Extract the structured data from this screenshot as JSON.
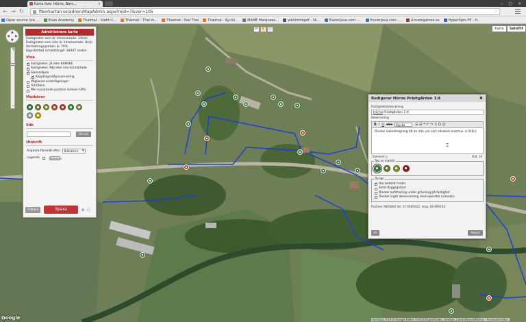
{
  "browser": {
    "tab_title": "Karta över Hörne, Bars…",
    "tab_close": "×",
    "address": "fiberkartan.se/admin/MapAdmin.aspx?mid=7&ver=105",
    "window_buttons": "– ▢ ×",
    "bookmarks": [
      {
        "label": "Open source live …",
        "color": "#3b7dd8"
      },
      {
        "label": "Khan Academy",
        "color": "#4a9e3f"
      },
      {
        "label": "Thaimat - Stekt ri…",
        "color": "#e07a1f"
      },
      {
        "label": "Thaimat - Thai m…",
        "color": "#e07a1f"
      },
      {
        "label": "Thaimat - Pad Thai",
        "color": "#e07a1f"
      },
      {
        "label": "Thaimat - Kyckli…",
        "color": "#e07a1f"
      },
      {
        "label": "MAME Marquees…",
        "color": "#777777"
      },
      {
        "label": "wkhtmltopdf - Sk…",
        "color": "#555555"
      },
      {
        "label": "EasierJava.com -…",
        "color": "#4477aa"
      },
      {
        "label": "EasierJava.com -…",
        "color": "#4477aa"
      },
      {
        "label": "Arcadegames.se",
        "color": "#aa3333"
      },
      {
        "label": "HyperSpin-FE - H…",
        "color": "#3366cc"
      }
    ]
  },
  "map": {
    "type_buttons": [
      "Karta",
      "Satellit"
    ],
    "top_icons": [
      "↶",
      "✋",
      "▭"
    ],
    "logo": "Google",
    "copyright": "Kartdata ©2013 Google Bilder ©2013 DigitalGlobe, GeoEye, Lantmäteriet/Metria – Användarvillkor",
    "pan_arrows": [
      "▲",
      "▼",
      "◀",
      "▶"
    ],
    "zoom": [
      "+",
      "−"
    ]
  },
  "admin": {
    "title": "Administrera karta",
    "stats": [
      "Fastigheter som är intresserade: 14(st)",
      "Fastigheter som inte är intresserade: 8(st)",
      "Anslutningsgraden är 79%",
      "Uppskattad schaktlängd: 34447 meter"
    ],
    "visa_header": "Visa",
    "visa_items": [
      {
        "label": "Fastigheter, JA eller KANSKE",
        "checked": true,
        "indent": false
      },
      {
        "label": "Fastigheter, NEJ eller inte kontaktade",
        "checked": true,
        "indent": false
      },
      {
        "label": "Fiberskåpen",
        "checked": true,
        "indent": false
      },
      {
        "label": "Kopplingsskåpsnumrering",
        "checked": true,
        "indent": true
      },
      {
        "label": "Vägkanal-underlägningar",
        "checked": false,
        "indent": false
      },
      {
        "label": "Områden",
        "checked": false,
        "indent": false
      },
      {
        "label": "Min nuvarande position (kräver GPS)",
        "checked": false,
        "indent": false
      }
    ],
    "markers_header": "Markörer",
    "marker_colors": [
      "#2e7d32",
      "#6d7a2a",
      "#8a8f2a",
      "#c24a1a",
      "#b23a1a",
      "#2e8a2e",
      "#8a8a2a",
      "#9aa0a6",
      "#c8a000"
    ],
    "search_header": "Sök",
    "search_button": "Sök/sök",
    "utskrift_header": "Utskrift",
    "print_label": "Anpassa föremål efter",
    "print_select": "Bildskärm",
    "legend_label": "Legende",
    "legend_toggle": "Skicka ut",
    "btn_left": "Tillbaka",
    "save_label": "Spara",
    "tiny_icons": "⚙ ⓘ"
  },
  "dialog": {
    "title": "Redigerar Hörne Prästgården 1:4",
    "close": "✖",
    "name_label": "Fastighetsbeteckning",
    "name_value_u": "Hörne",
    "name_value_rest": " Prästgården 1:4",
    "desc_label": "Beskrivning",
    "toolbar_items": [
      "B",
      "I",
      "U",
      "abc"
    ],
    "format_select": "Stycke",
    "toolbar_tail": "☰ ☰ ❝ ↶ ↷ ⚓ Ω ☺",
    "desc_text": "Önskar kabeldragning då de inte vet vart elkabeln kommer in ifrån]",
    "element_path": "Element: p",
    "word_count": "Ord: 10",
    "type_legend": "Typ av markör",
    "type_colors": [
      "#2e7d32",
      "#6d7a2a",
      "#8a8f2a",
      "#8a1f1f"
    ],
    "ovrigt_legend": "Övrigt",
    "ovrigt_items": [
      {
        "label": "Har betalat insats",
        "checked": true
      },
      {
        "label": "Avtal Ifyggsgivtad",
        "checked": false
      },
      {
        "label": "Önskar avfiltrering under grävning på fastighet",
        "checked": false
      },
      {
        "label": "Önskar inget abonnemang med operatör (vilande)",
        "checked": false
      }
    ],
    "position": "Position (WGS84) lat: 57.6565022, long: 16.095142",
    "ok": "Ok",
    "cancel": "Avbryt"
  }
}
